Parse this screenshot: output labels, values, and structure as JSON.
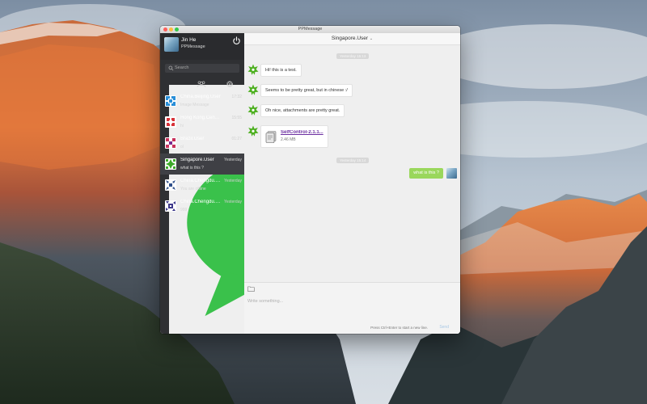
{
  "window": {
    "title": "PPMessage"
  },
  "profile": {
    "name": "Jin He",
    "app": "PPMessage"
  },
  "search": {
    "placeholder": "Search"
  },
  "conversations": [
    {
      "name": "China.Beijing.User",
      "time": "17:32",
      "message": "Image Message",
      "avatar": "pattern-blue"
    },
    {
      "name": "Hong Kong.Centr...",
      "time": "15:55",
      "message": "hi",
      "avatar": "pattern-red"
    },
    {
      "name": "Brazil.User",
      "time": "01:27",
      "message": "ol",
      "avatar": "pattern-pink"
    },
    {
      "name": "Singapore.User",
      "time": "Yesterday",
      "message": "what is this ?",
      "avatar": "pattern-green"
    },
    {
      "name": "China.Chengdu.U...",
      "time": "Yesterday",
      "message": "You are offline",
      "avatar": "pattern-navy"
    },
    {
      "name": "China.Chengdu.U...",
      "time": "Yesterday",
      "message": "999",
      "avatar": "pattern-purple"
    }
  ],
  "chat": {
    "title": "Singapore.User",
    "timestamps": [
      "Yesterday 15:13",
      "Yesterday 15:14"
    ],
    "incoming": [
      "Hi! this is a test.",
      "Seems to be pretty great, but in chinese :/",
      "Oh nice, attachments are pretty great."
    ],
    "file": {
      "name": "SelfControl-2.1.1...",
      "size": "2.46 MB"
    },
    "outgoing": "what is this ?"
  },
  "composer": {
    "placeholder": "Write something...",
    "hint": "Press Ctrl+Enter to start a new line.",
    "send_label": "Send"
  },
  "colors": {
    "sidebar": "#2f3033",
    "active_row": "#3f4045",
    "outgoing_bubble": "#9ad75c",
    "file_link": "#6b2ea0",
    "incoming_avatar": "#4caf1e"
  }
}
